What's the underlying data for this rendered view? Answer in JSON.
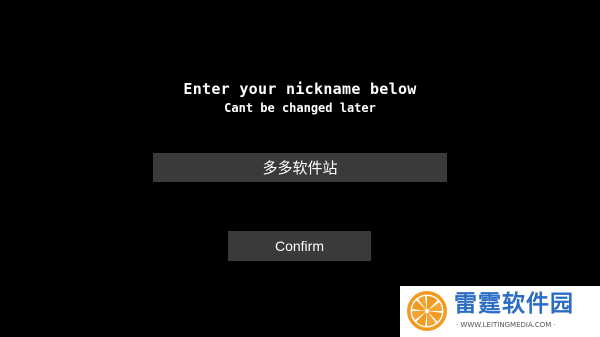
{
  "dialog": {
    "title": "Enter your nickname below",
    "subtitle": "Cant be changed later",
    "nickname_value": "多多软件站",
    "confirm_label": "Confirm"
  },
  "watermark": {
    "name": "雷霆软件园",
    "url": "· WWW.LEITINGMEDIA.COM ·",
    "icon": "orange-slice-icon"
  },
  "colors": {
    "background": "#000000",
    "field": "#3a3a3a",
    "text": "#ffffff",
    "watermark_blue": "#2b6cc4",
    "watermark_orange": "#f29a1d"
  }
}
